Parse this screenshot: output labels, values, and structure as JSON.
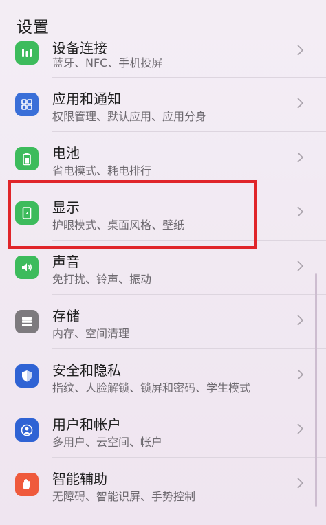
{
  "header": {
    "title": "设置"
  },
  "items": [
    {
      "label": "设备连接",
      "sub": "蓝牙、NFC、手机投屏",
      "icon": "device-connection-icon",
      "color": "#3dbb5c"
    },
    {
      "label": "应用和通知",
      "sub": "权限管理、默认应用、应用分身",
      "icon": "apps-grid-icon",
      "color": "#3a6fd8"
    },
    {
      "label": "电池",
      "sub": "省电模式、耗电排行",
      "icon": "battery-icon",
      "color": "#3dbb5c"
    },
    {
      "label": "显示",
      "sub": "护眼模式、桌面风格、壁纸",
      "icon": "display-icon",
      "color": "#3dbb5c"
    },
    {
      "label": "声音",
      "sub": "免打扰、铃声、振动",
      "icon": "speaker-icon",
      "color": "#3dbb5c"
    },
    {
      "label": "存储",
      "sub": "内存、空间清理",
      "icon": "storage-icon",
      "color": "#7d7a7e"
    },
    {
      "label": "安全和隐私",
      "sub": "指纹、人脸解锁、锁屏和密码、学生模式",
      "icon": "shield-icon",
      "color": "#2f63d4"
    },
    {
      "label": "用户和帐户",
      "sub": "多用户、云空间、帐户",
      "icon": "user-account-icon",
      "color": "#2f63d4"
    },
    {
      "label": "智能辅助",
      "sub": "无障碍、智能识屏、手势控制",
      "icon": "hand-icon",
      "color": "#ef5a3c"
    }
  ]
}
